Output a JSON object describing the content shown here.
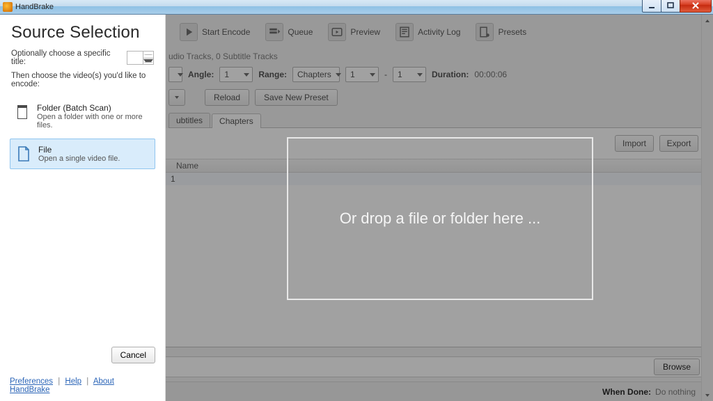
{
  "window": {
    "title": "HandBrake"
  },
  "toolbar": {
    "items": [
      {
        "label": "Start Encode"
      },
      {
        "label": "Queue"
      },
      {
        "label": "Preview"
      },
      {
        "label": "Activity Log"
      },
      {
        "label": "Presets"
      }
    ]
  },
  "info_line": "udio Tracks, 0 Subtitle Tracks",
  "titlebar_controls": {
    "angle_label": "Angle:",
    "angle_value": "1",
    "range_label": "Range:",
    "range_mode": "Chapters",
    "range_from": "1",
    "range_sep": "-",
    "range_to": "1",
    "duration_label": "Duration:",
    "duration_value": "00:00:06"
  },
  "action_row": {
    "reload": "Reload",
    "save_preset": "Save New Preset"
  },
  "tabs": {
    "subtitles": "ubtitles",
    "chapters": "Chapters"
  },
  "pane": {
    "import": "Import",
    "export": "Export",
    "col_name": "Name",
    "row0": "1",
    "browse": "Browse"
  },
  "statusbar": {
    "when_done_label": "When Done:",
    "when_done_value": "Do nothing"
  },
  "dropzone": "Or drop a file or folder here ...",
  "sidebar": {
    "title": "Source Selection",
    "opt_label": "Optionally choose a specific title:",
    "title_spinner": "",
    "hint": "Then choose the video(s) you'd like to encode:",
    "folder": {
      "title": "Folder (Batch Scan)",
      "desc": "Open a folder with one or more files."
    },
    "file": {
      "title": "File",
      "desc": "Open a single video file."
    },
    "cancel": "Cancel",
    "links": {
      "preferences": "Preferences",
      "help": "Help",
      "about": "About HandBrake"
    }
  }
}
